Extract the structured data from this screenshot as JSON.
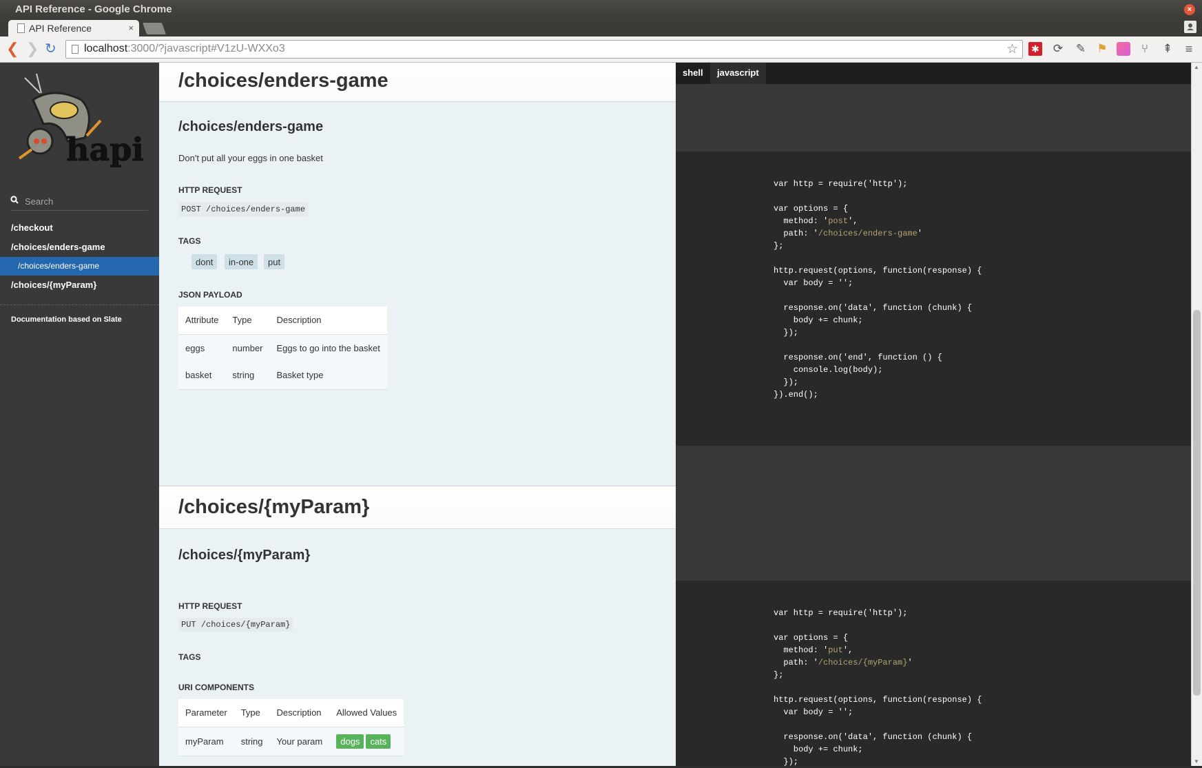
{
  "window": {
    "title": "API Reference - Google Chrome",
    "close_glyph": "×"
  },
  "tab": {
    "label": "API Reference",
    "close_glyph": "×"
  },
  "toolbar": {
    "back_glyph": "❮",
    "forward_glyph": "❯",
    "reload_glyph": "↻",
    "url_host": "localhost",
    "url_rest": ":3000/?javascript#V1zU-WXXo3",
    "star_glyph": "☆",
    "menu_glyph": "≡",
    "extensions": [
      "asterisk-icon",
      "sync-icon",
      "eyedropper-icon",
      "flag-icon",
      "gradient-icon",
      "fork-icon",
      "tree-icon"
    ]
  },
  "sidebar": {
    "logo_text": "hapi",
    "search_placeholder": "Search",
    "items": [
      {
        "label": "/checkout"
      },
      {
        "label": "/choices/enders-game"
      },
      {
        "label": "/choices/enders-game",
        "sub": true,
        "active": true
      },
      {
        "label": "/choices/{myParam}"
      }
    ],
    "footer": "Documentation based on Slate"
  },
  "sections": {
    "enders": {
      "title": "/choices/enders-game",
      "subtitle": "/choices/enders-game",
      "description": "Don't put all your eggs in one basket",
      "http_request_heading": "HTTP REQUEST",
      "http_method": "POST",
      "http_path": "/choices/enders-game",
      "tags_heading": "TAGS",
      "tags": [
        "dont",
        "in-one",
        "put"
      ],
      "payload_heading": "JSON PAYLOAD",
      "payload_columns": [
        "Attribute",
        "Type",
        "Description"
      ],
      "payload_rows": [
        [
          "eggs",
          "number",
          "Eggs to go into the basket"
        ],
        [
          "basket",
          "string",
          "Basket type"
        ]
      ]
    },
    "myparam": {
      "title": "/choices/{myParam}",
      "subtitle": "/choices/{myParam}",
      "http_request_heading": "HTTP REQUEST",
      "http_method": "PUT",
      "http_path": "/choices/{myParam}",
      "tags_heading": "TAGS",
      "uri_heading": "URI COMPONENTS",
      "uri_columns": [
        "Parameter",
        "Type",
        "Description",
        "Allowed Values"
      ],
      "uri_rows": [
        {
          "param": "myParam",
          "type": "string",
          "description": "Your param",
          "allowed": [
            "dogs",
            "cats"
          ]
        }
      ]
    }
  },
  "code": {
    "tabs": [
      "shell",
      "javascript"
    ],
    "active_tab": "javascript",
    "block1": {
      "method": "post",
      "path": "/choices/enders-game"
    },
    "block2": {
      "method": "put",
      "path": "/choices/{myParam}"
    }
  },
  "colors": {
    "sidebar_bg": "#393939",
    "active_nav": "#2467af",
    "content_bg": "#eaf2f6",
    "code_bg": "#292929",
    "string_color": "#b0a56f",
    "allowed_badge": "#57b45c"
  }
}
